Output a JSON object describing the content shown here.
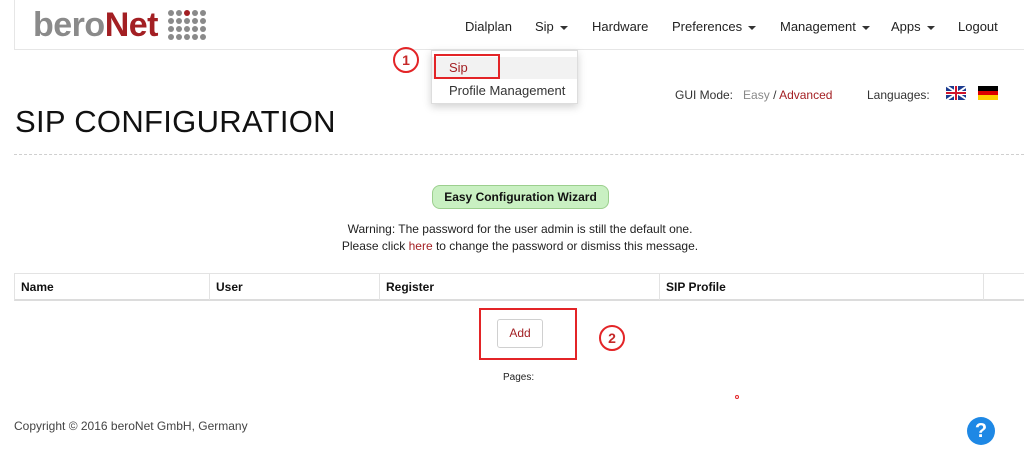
{
  "brand": {
    "part1": "bero",
    "part2": "Net"
  },
  "nav": {
    "dialplan": "Dialplan",
    "sip": "Sip",
    "hardware": "Hardware",
    "preferences": "Preferences",
    "management": "Management",
    "apps": "Apps",
    "logout": "Logout"
  },
  "sip_dropdown": {
    "items": [
      "Sip",
      "Profile Management"
    ]
  },
  "annotations": {
    "step1": "1",
    "step2": "2"
  },
  "gui_mode": {
    "label": "GUI Mode:",
    "easy": "Easy",
    "separator": "/",
    "advanced": "Advanced"
  },
  "languages": {
    "label": "Languages:"
  },
  "page": {
    "title": "SIP CONFIGURATION"
  },
  "wizard": {
    "label": "Easy Configuration Wizard"
  },
  "warning": {
    "line1": "Warning: The password for the user admin is still the default one.",
    "line2_pre": "Please click ",
    "line2_link": "here",
    "line2_post": " to change the password or dismiss this message."
  },
  "table": {
    "columns": [
      "Name",
      "User",
      "Register",
      "SIP Profile",
      ""
    ]
  },
  "add_button": {
    "label": "Add"
  },
  "pages": {
    "label": "Pages:"
  },
  "footer": {
    "copyright": "Copyright © 2016 beroNet GmbH, Germany"
  },
  "help": {
    "label": "?"
  },
  "colors": {
    "brand_red": "#a31f23",
    "annotation_red": "#e32427",
    "wizard_green": "#c9f0c2",
    "help_blue": "#1e88e5"
  }
}
